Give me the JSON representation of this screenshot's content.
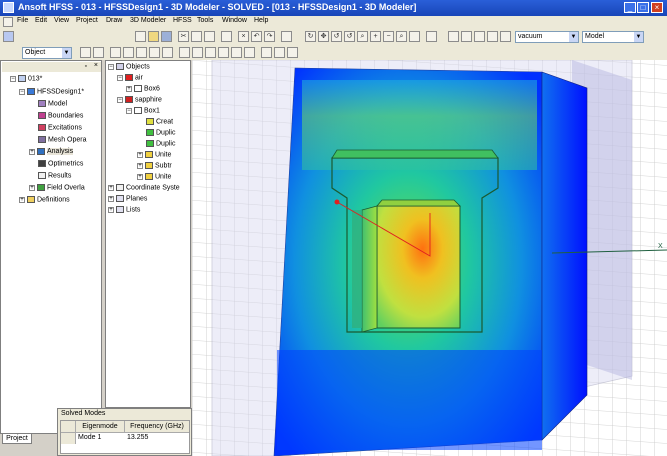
{
  "window": {
    "title": "Ansoft HFSS - 013 - HFSSDesign1 - 3D Modeler - SOLVED - [013 - HFSSDesign1 - 3D Modeler]"
  },
  "menu": [
    "File",
    "Edit",
    "View",
    "Project",
    "Draw",
    "3D Modeler",
    "HFSS",
    "Tools",
    "Window",
    "Help"
  ],
  "toolbar": {
    "select_combo": "Object",
    "material_combo": "vacuum",
    "mode_combo": "Model"
  },
  "project_tree": [
    {
      "label": "013*",
      "depth": 0
    },
    {
      "label": "HFSSDesign1*",
      "depth": 1
    },
    {
      "label": "Model",
      "depth": 2
    },
    {
      "label": "Boundaries",
      "depth": 2
    },
    {
      "label": "Excitations",
      "depth": 2
    },
    {
      "label": "Mesh Opera",
      "depth": 2
    },
    {
      "label": "Analysis",
      "depth": 2
    },
    {
      "label": "Optimetrics",
      "depth": 2
    },
    {
      "label": "Results",
      "depth": 2
    },
    {
      "label": "Field Overla",
      "depth": 2
    },
    {
      "label": "Definitions",
      "depth": 1
    }
  ],
  "model_tree": [
    {
      "label": "Objects",
      "depth": 0
    },
    {
      "label": "air",
      "depth": 1
    },
    {
      "label": "Box6",
      "depth": 2
    },
    {
      "label": "sapphire",
      "depth": 1
    },
    {
      "label": "Box1",
      "depth": 2
    },
    {
      "label": "Creat",
      "depth": 3
    },
    {
      "label": "Duplic",
      "depth": 3
    },
    {
      "label": "Duplic",
      "depth": 3
    },
    {
      "label": "Unite",
      "depth": 3
    },
    {
      "label": "Subtr",
      "depth": 3
    },
    {
      "label": "Unite",
      "depth": 3
    },
    {
      "label": "Coordinate Syste",
      "depth": 0
    },
    {
      "label": "Planes",
      "depth": 0
    },
    {
      "label": "Lists",
      "depth": 0
    }
  ],
  "tabs": {
    "project": "Project"
  },
  "solved_modes": {
    "title": "Solved Modes",
    "columns": [
      "Eigenmode",
      "Frequency (GHz)"
    ],
    "rows": [
      [
        "Mode 1",
        "13.255"
      ]
    ]
  },
  "axis_label": "X",
  "colors": {
    "titlebar": "#1c4cc0",
    "field_low": "#0000ff",
    "field_high": "#ff4000"
  }
}
